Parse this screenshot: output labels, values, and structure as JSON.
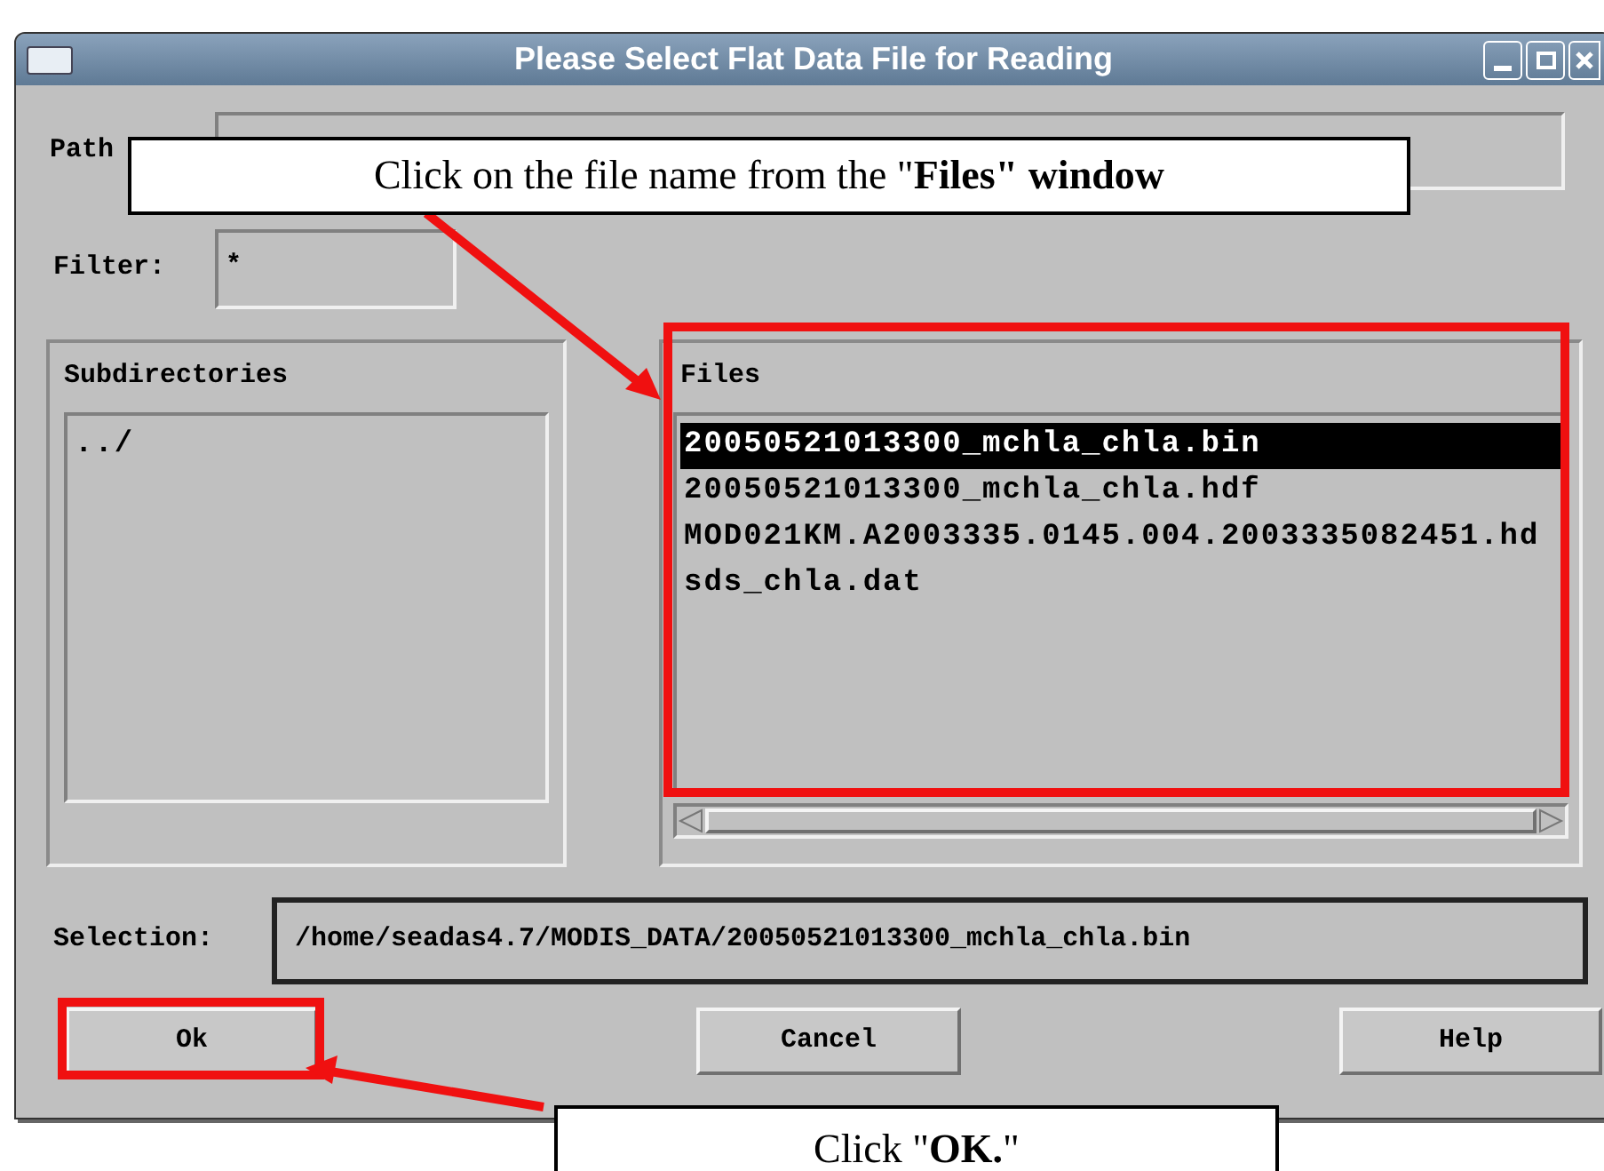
{
  "window": {
    "title": "Please Select Flat Data File for Reading"
  },
  "path": {
    "label": "Path"
  },
  "filter": {
    "label": "Filter:",
    "value": "*"
  },
  "subdirectories": {
    "title": "Subdirectories",
    "items": [
      {
        "label": "../",
        "selected": false
      }
    ]
  },
  "files": {
    "title": "Files",
    "items": [
      {
        "label": "20050521013300_mchla_chla.bin",
        "selected": true
      },
      {
        "label": "20050521013300_mchla_chla.hdf",
        "selected": false
      },
      {
        "label": "MOD021KM.A2003335.0145.004.2003335082451.hd",
        "selected": false
      },
      {
        "label": "sds_chla.dat",
        "selected": false
      }
    ]
  },
  "selection": {
    "label": "Selection:",
    "value": "/home/seadas4.7/MODIS_DATA/20050521013300_mchla_chla.bin"
  },
  "buttons": [
    "Ok",
    "Cancel",
    "Help"
  ],
  "annotations": [
    {
      "text": "Click on the file name from the \"**Files\" window**"
    },
    {
      "text": "Click \"**OK.**\""
    }
  ]
}
